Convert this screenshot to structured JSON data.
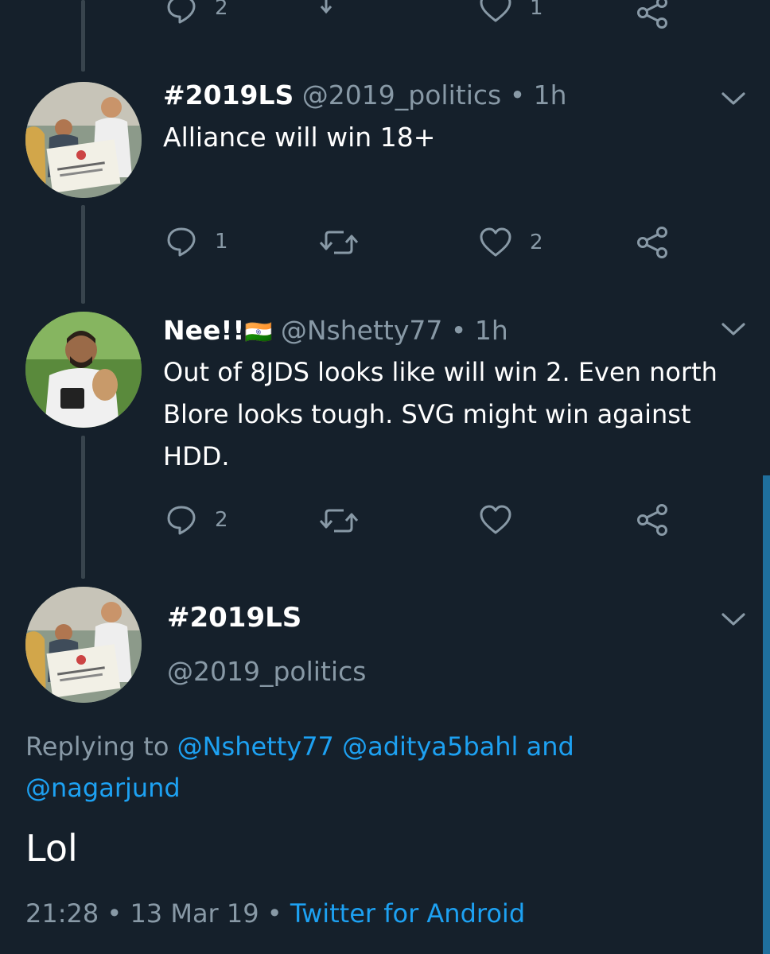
{
  "top_actions": {
    "reply_count": "2",
    "like_count": "1"
  },
  "tweets": [
    {
      "name": "#2019LS",
      "handle": "@2019_politics",
      "time": "1h",
      "text": "Alliance will win 18+",
      "reply_count": "1",
      "like_count": "2"
    },
    {
      "name": "Nee!!",
      "flag": "🇮🇳",
      "handle": "@Nshetty77",
      "time": "1h",
      "text_line1": "Out of 8JDS looks like will win 2. Even north",
      "text_line2": "Blore looks tough. SVG might win against",
      "text_line3": "HDD.",
      "reply_count": "2",
      "like_count": ""
    }
  ],
  "focused": {
    "name": "#2019LS",
    "handle": "@2019_politics",
    "replying_to_label": "Replying to",
    "mention1": "@Nshetty77",
    "mention2": "@aditya5bahl",
    "and_label": "and",
    "mention3": "@nagarjund",
    "text": "Lol",
    "time": "21:28",
    "date": "13 Mar 19",
    "source": "Twitter for Android"
  },
  "separator": "•",
  "icons": {
    "reply": "reply-icon",
    "retweet": "retweet-icon",
    "like": "heart-icon",
    "share": "share-icon",
    "more": "chevron-down-icon"
  }
}
